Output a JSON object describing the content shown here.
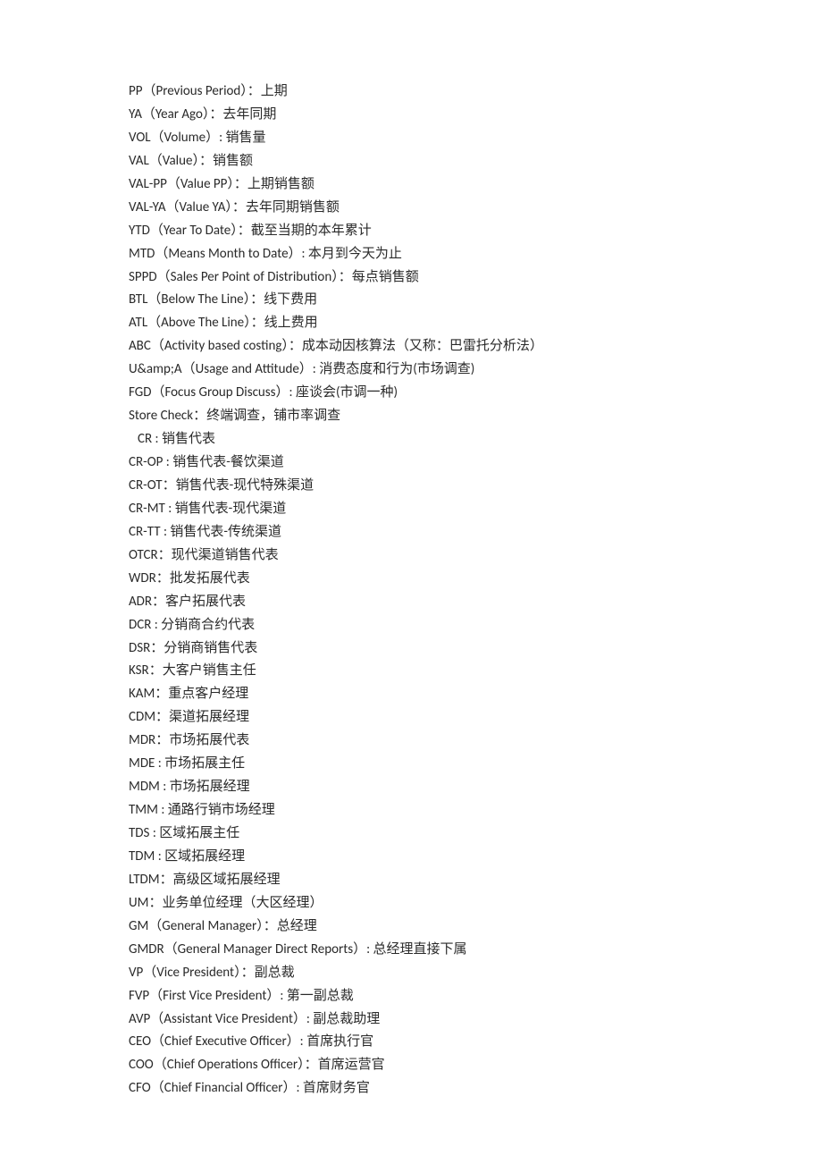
{
  "lines": [
    {
      "text": "PP（Previous Period）：上期",
      "indent": false
    },
    {
      "text": "YA（Year Ago）：去年同期",
      "indent": false
    },
    {
      "text": "VOL（Volume）: 销售量",
      "indent": false
    },
    {
      "text": "VAL（Value）：销售额",
      "indent": false
    },
    {
      "text": "VAL-PP（Value PP）：上期销售额",
      "indent": false
    },
    {
      "text": "VAL-YA（Value YA）：去年同期销售额",
      "indent": false
    },
    {
      "text": "YTD（Year To Date）：截至当期的本年累计",
      "indent": false
    },
    {
      "text": "MTD（Means Month to Date）: 本月到今天为止",
      "indent": false
    },
    {
      "text": "SPPD（Sales Per Point of Distribution）：每点销售额",
      "indent": false
    },
    {
      "text": "BTL（Below The Line）：线下费用",
      "indent": false
    },
    {
      "text": "ATL（Above The Line）：线上费用",
      "indent": false
    },
    {
      "text": "ABC（Activity based costing）：成本动因核算法（又称：巴雷托分析法）",
      "indent": false
    },
    {
      "text": "U&amp;A（Usage and Attitude）: 消费态度和行为(市场调查)",
      "indent": false
    },
    {
      "text": "FGD（Focus Group Discuss）: 座谈会(市调一种)",
      "indent": false
    },
    {
      "text": "Store Check：终端调查，铺市率调查",
      "indent": false
    },
    {
      "text": "CR : 销售代表",
      "indent": true
    },
    {
      "text": "CR-OP : 销售代表-餐饮渠道",
      "indent": false
    },
    {
      "text": "CR-OT：销售代表-现代特殊渠道",
      "indent": false
    },
    {
      "text": "CR-MT : 销售代表-现代渠道",
      "indent": false
    },
    {
      "text": "CR-TT : 销售代表-传统渠道",
      "indent": false
    },
    {
      "text": "OTCR：现代渠道销售代表",
      "indent": false
    },
    {
      "text": "WDR：批发拓展代表",
      "indent": false
    },
    {
      "text": "ADR：客户拓展代表",
      "indent": false
    },
    {
      "text": "DCR : 分销商合约代表",
      "indent": false
    },
    {
      "text": "DSR：分销商销售代表",
      "indent": false
    },
    {
      "text": "KSR：大客户销售主任",
      "indent": false
    },
    {
      "text": "KAM：重点客户经理",
      "indent": false
    },
    {
      "text": "CDM：渠道拓展经理",
      "indent": false
    },
    {
      "text": "MDR：市场拓展代表",
      "indent": false
    },
    {
      "text": "MDE : 市场拓展主任",
      "indent": false
    },
    {
      "text": "MDM : 市场拓展经理",
      "indent": false
    },
    {
      "text": "TMM : 通路行销市场经理",
      "indent": false
    },
    {
      "text": "TDS : 区域拓展主任",
      "indent": false
    },
    {
      "text": "TDM : 区域拓展经理",
      "indent": false
    },
    {
      "text": "LTDM：高级区域拓展经理",
      "indent": false
    },
    {
      "text": "UM：业务单位经理（大区经理）",
      "indent": false
    },
    {
      "text": "GM（General Manager）：总经理",
      "indent": false
    },
    {
      "text": "GMDR（General Manager Direct Reports）: 总经理直接下属",
      "indent": false
    },
    {
      "text": "VP（Vice President）：副总裁",
      "indent": false
    },
    {
      "text": "FVP（First Vice President）: 第一副总裁",
      "indent": false
    },
    {
      "text": "AVP（Assistant Vice President）: 副总裁助理",
      "indent": false
    },
    {
      "text": "CEO（Chief Executive Officer）: 首席执行官",
      "indent": false
    },
    {
      "text": "COO（Chief Operations Officer）：首席运营官",
      "indent": false
    },
    {
      "text": "CFO（Chief Financial Officer）: 首席财务官",
      "indent": false
    }
  ]
}
